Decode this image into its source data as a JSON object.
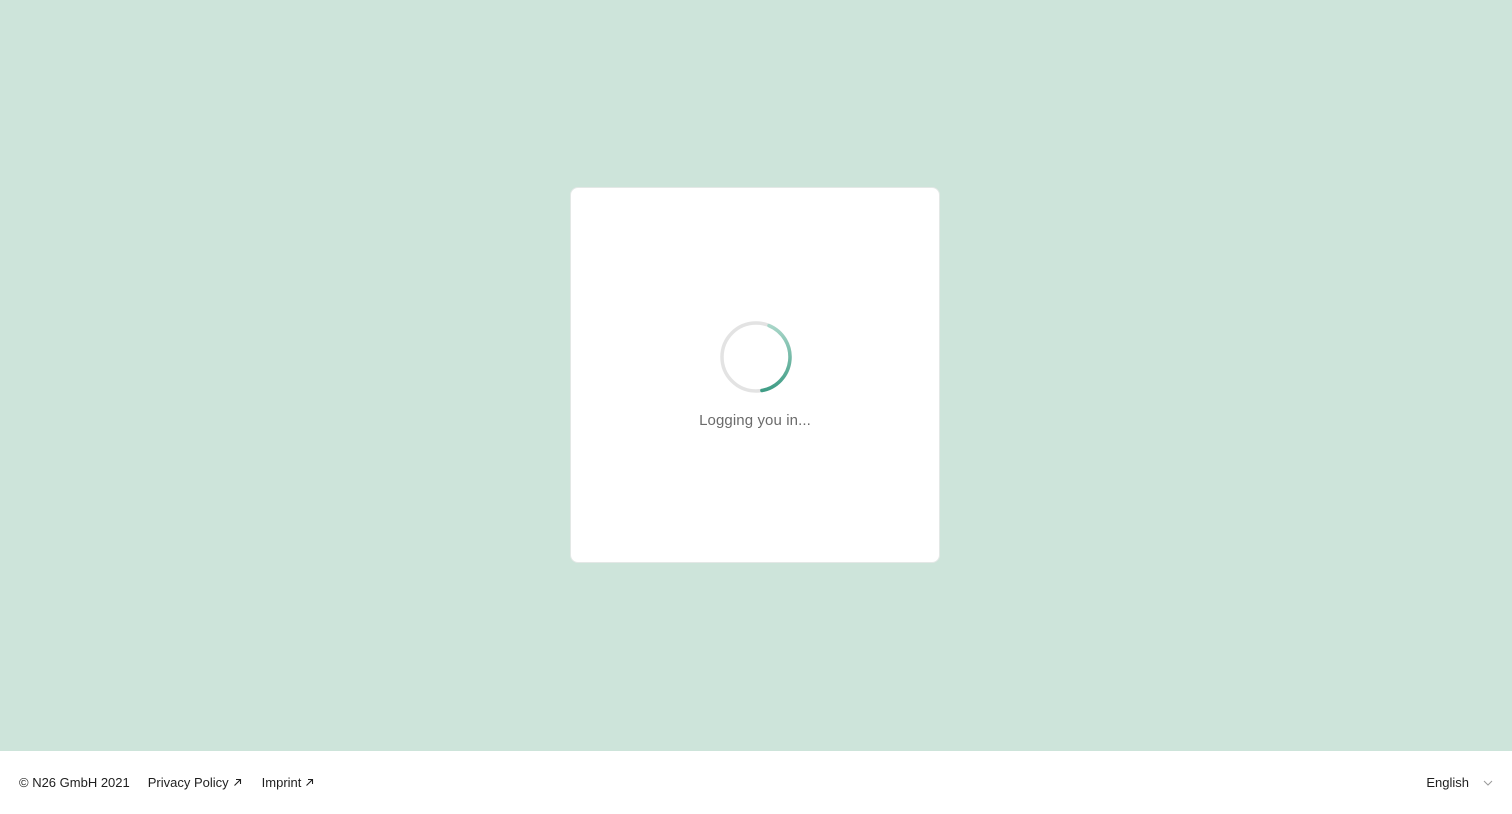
{
  "loading": {
    "message": "Logging you in..."
  },
  "footer": {
    "copyright": "© N26 GmbH 2021",
    "links": [
      {
        "label": "Privacy Policy"
      },
      {
        "label": "Imprint"
      }
    ],
    "language": "English"
  },
  "colors": {
    "background": "#cde4da",
    "spinner_track": "#e3e3e3",
    "spinner_accent": "#4ea692"
  },
  "icons": {
    "external_link": "arrow-up-right-icon",
    "language_dropdown": "chevron-down-icon",
    "spinner": "loading-spinner-icon"
  }
}
